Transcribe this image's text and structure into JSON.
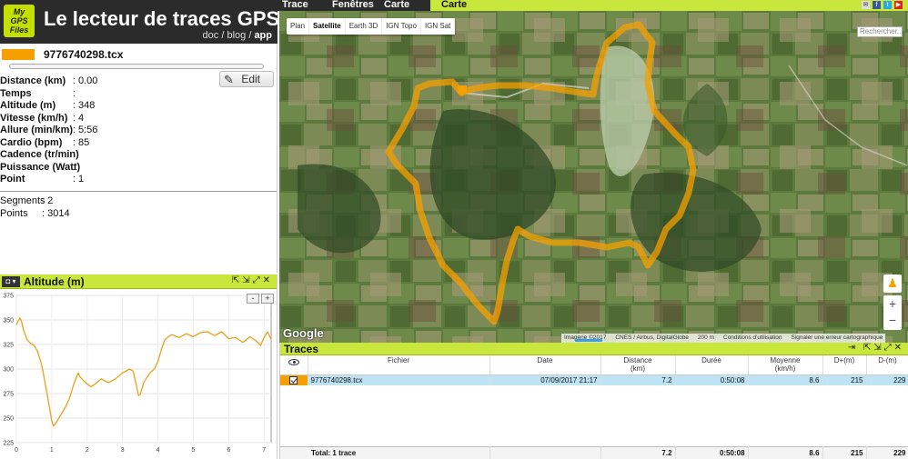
{
  "header": {
    "logo_lines": [
      "My",
      "GPS",
      "Files"
    ],
    "title": "Le lecteur de traces GPS",
    "links": {
      "doc": "doc",
      "sep1": " / ",
      "blog": "blog",
      "sep2": " / ",
      "app": "app"
    }
  },
  "nav": {
    "items": [
      "Trace",
      "Fenêtres",
      "Carte"
    ],
    "active": "Carte"
  },
  "track": {
    "filename": "9776740298.tcx",
    "color": "#f5a000",
    "progress": 0.0,
    "edit_label": "Edit",
    "stats": [
      {
        "label": "Distance (km)",
        "value": "0.00"
      },
      {
        "label": "Temps",
        "value": ""
      },
      {
        "label": "Altitude (m)",
        "value": "348"
      },
      {
        "label": "Vitesse (km/h)",
        "value": "4"
      },
      {
        "label": "Allure (min/km)",
        "value": "5:56"
      },
      {
        "label": "Cardio (bpm)",
        "value": "85"
      },
      {
        "label": "Cadence (tr/min)",
        "value": ""
      },
      {
        "label": "Puissance (Watt)",
        "value": ""
      },
      {
        "label": "Point",
        "value": "1"
      }
    ],
    "segments_label": "Segments",
    "segments_value": "2",
    "points_label": "Points",
    "points_value": "3014"
  },
  "altitude_panel": {
    "title": "Altitude (m)",
    "zoom_out": "-",
    "zoom_in": "+"
  },
  "chart_data": {
    "type": "line",
    "title": "Altitude (m)",
    "xlabel": "",
    "ylabel": "",
    "xlim": [
      0,
      7.2
    ],
    "ylim": [
      225,
      375
    ],
    "xticks": [
      0,
      1,
      2,
      3,
      4,
      5,
      6,
      7
    ],
    "yticks": [
      225,
      250,
      275,
      300,
      325,
      350,
      375
    ],
    "color": "#e8a21c",
    "series": [
      {
        "x": [
          0,
          0.05,
          0.1,
          0.15,
          0.2,
          0.3,
          0.4,
          0.5,
          0.6,
          0.7,
          0.75,
          0.8,
          0.85,
          0.9,
          0.95,
          1.0,
          1.05,
          1.1,
          1.2,
          1.3,
          1.4,
          1.5,
          1.6,
          1.7,
          1.75,
          1.8,
          1.9,
          2.0,
          2.1,
          2.2,
          2.4,
          2.6,
          2.8,
          3.0,
          3.2,
          3.3,
          3.4,
          3.45,
          3.5,
          3.6,
          3.7,
          3.8,
          3.9,
          4.0,
          4.1,
          4.2,
          4.3,
          4.4,
          4.6,
          4.8,
          5.0,
          5.2,
          5.4,
          5.6,
          5.8,
          6.0,
          6.2,
          6.4,
          6.6,
          6.8,
          6.9,
          7.0,
          7.1,
          7.2
        ],
        "y": [
          345,
          349,
          352,
          348,
          340,
          330,
          326,
          324,
          318,
          306,
          298,
          288,
          278,
          268,
          258,
          247,
          242,
          244,
          250,
          256,
          262,
          270,
          282,
          292,
          296,
          292,
          288,
          285,
          282,
          284,
          290,
          286,
          290,
          296,
          300,
          298,
          282,
          273,
          274,
          286,
          292,
          297,
          300,
          308,
          320,
          330,
          333,
          335,
          332,
          336,
          333,
          337,
          338,
          334,
          338,
          331,
          332,
          327,
          333,
          328,
          324,
          332,
          338,
          330
        ]
      }
    ]
  },
  "map": {
    "types": [
      "Plan",
      "Satellite",
      "Earth 3D",
      "IGN Topo",
      "IGN Sat"
    ],
    "selected_type": "Satellite",
    "search_placeholder": "Rechercher...",
    "google": "Google",
    "attribution": [
      "Imagerie ©2017",
      "CNES / Airbus, DigitalGlobe",
      "200 m",
      "Conditions d'utilisation",
      "Signaler une erreur cartographique"
    ],
    "zoom_in": "+",
    "zoom_out": "−"
  },
  "traces": {
    "title": "Traces",
    "columns": [
      {
        "label": "",
        "sub": ""
      },
      {
        "label": "Fichier",
        "sub": ""
      },
      {
        "label": "Date",
        "sub": ""
      },
      {
        "label": "Distance",
        "sub": "(km)"
      },
      {
        "label": "Durée",
        "sub": ""
      },
      {
        "label": "Moyenne",
        "sub": "(km/h)"
      },
      {
        "label": "D+(m)",
        "sub": ""
      },
      {
        "label": "D-(m)",
        "sub": ""
      }
    ],
    "rows": [
      {
        "file": "9776740298.tcx",
        "date": "07/09/2017 21:17",
        "distance": "7.2",
        "duration": "0:50:08",
        "avg": "8.6",
        "dplus": "215",
        "dminus": "229"
      }
    ],
    "total": {
      "label": "Total: 1 trace",
      "date": "",
      "distance": "7.2",
      "duration": "0:50:08",
      "avg": "8.6",
      "dplus": "215",
      "dminus": "229"
    }
  }
}
